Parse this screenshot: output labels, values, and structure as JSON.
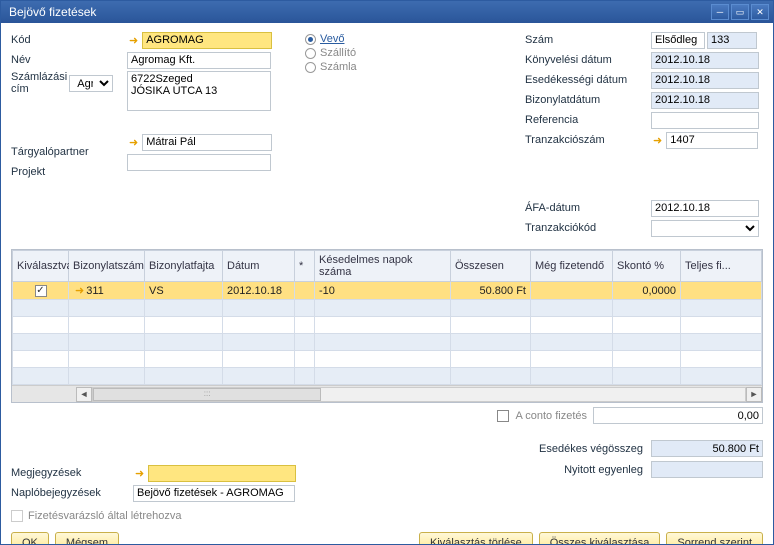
{
  "window": {
    "title": "Bejövő fizetések"
  },
  "labels": {
    "code": "Kód",
    "name": "Név",
    "billaddr": "Számlázási cím",
    "negpartner": "Tárgyalópartner",
    "project": "Projekt",
    "number": "Szám",
    "postdate": "Könyvelési dátum",
    "duedate": "Esedékességi dátum",
    "docdate": "Bizonylatdátum",
    "reference": "Referencia",
    "transnum": "Tranzakciószám",
    "vatdate": "ÁFA-dátum",
    "transcode": "Tranzakciókód",
    "aconto": "A conto fizetés",
    "remarks": "Megjegyzések",
    "journal": "Naplóbejegyzések",
    "duetotal": "Esedékes végösszeg",
    "openbal": "Nyitott egyenleg",
    "wizard": "Fizetésvarázsló által létrehozva"
  },
  "radios": {
    "vevo": "Vevő",
    "szallito": "Szállító",
    "szamla": "Számla"
  },
  "form": {
    "code": "AGROMAG",
    "name": "Agromag Kft.",
    "billaddr_type": "Agro",
    "address": "6722Szeged\nJÓSIKA UTCA 13",
    "negpartner": "Mátrai Pál",
    "project": "",
    "number_type": "Elsődleg",
    "number": "133",
    "postdate": "2012.10.18",
    "duedate": "2012.10.18",
    "docdate": "2012.10.18",
    "reference": "",
    "transnum": "1407",
    "vatdate": "2012.10.18",
    "transcode": "",
    "aconto_value": "0,00",
    "remarks": "",
    "journal": "Bejövő fizetések - AGROMAG",
    "duetotal": "50.800 Ft",
    "openbal": ""
  },
  "grid": {
    "cols": [
      "Kiválasztva",
      "Bizonylatszám",
      "Bizonylatfajta",
      "Dátum",
      "*",
      "Késedelmes napok száma",
      "Összesen",
      "Még fizetendő",
      "Skontó %",
      "Teljes fi..."
    ],
    "rows": [
      {
        "selected": true,
        "docnum": "311",
        "doctype": "VS",
        "date": "2012.10.18",
        "overdue": "-10",
        "total": "50.800 Ft",
        "topay": "",
        "discount": "0,0000"
      }
    ]
  },
  "buttons": {
    "ok": "OK",
    "cancel": "Mégsem",
    "clear": "Kiválasztás törlése",
    "selall": "Összes kiválasztása",
    "sort": "Sorrend szerint"
  }
}
